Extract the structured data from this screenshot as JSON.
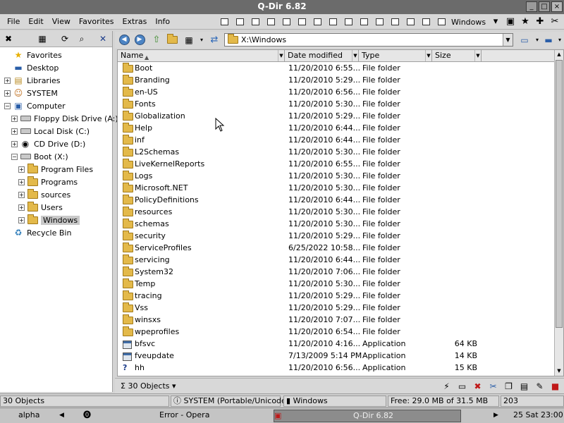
{
  "window": {
    "title": "Q-Dir 6.82"
  },
  "menu": [
    "File",
    "Edit",
    "View",
    "Favorites",
    "Extras",
    "Info"
  ],
  "menubar_right": {
    "windows_label": "Windows"
  },
  "tree": [
    {
      "label": "Favorites",
      "icon": "star-icon",
      "level": 0,
      "expander": ""
    },
    {
      "label": "Desktop",
      "icon": "desktop-icon",
      "level": 0,
      "expander": ""
    },
    {
      "label": "Libraries",
      "icon": "library-icon",
      "level": 0,
      "expander": "+"
    },
    {
      "label": "SYSTEM",
      "icon": "user-icon",
      "level": 0,
      "expander": "+"
    },
    {
      "label": "Computer",
      "icon": "computer-icon",
      "level": 0,
      "expander": "-"
    },
    {
      "label": "Floppy Disk Drive (A:)",
      "icon": "drive-icon",
      "level": 1,
      "expander": "+"
    },
    {
      "label": "Local Disk (C:)",
      "icon": "drive-icon",
      "level": 1,
      "expander": "+"
    },
    {
      "label": "CD Drive (D:)",
      "icon": "cd-icon",
      "level": 1,
      "expander": "+"
    },
    {
      "label": "Boot (X:)",
      "icon": "drive-icon",
      "level": 1,
      "expander": "-"
    },
    {
      "label": "Program Files",
      "icon": "folder-icon",
      "level": 2,
      "expander": "+"
    },
    {
      "label": "Programs",
      "icon": "folder-icon",
      "level": 2,
      "expander": "+"
    },
    {
      "label": "sources",
      "icon": "folder-icon",
      "level": 2,
      "expander": "+"
    },
    {
      "label": "Users",
      "icon": "folder-icon",
      "level": 2,
      "expander": "+"
    },
    {
      "label": "Windows",
      "icon": "folder-icon",
      "level": 2,
      "expander": "+",
      "selected": true
    },
    {
      "label": "Recycle Bin",
      "icon": "recycle-bin-icon",
      "level": 0,
      "expander": ""
    }
  ],
  "address": {
    "path": "X:\\Windows"
  },
  "columns": {
    "name": "Name",
    "date": "Date modified",
    "type": "Type",
    "size": "Size"
  },
  "files": [
    {
      "name": "Boot",
      "date": "11/20/2010 6:55...",
      "type": "File folder",
      "size": "",
      "icon": "folder-icon"
    },
    {
      "name": "Branding",
      "date": "11/20/2010 5:29...",
      "type": "File folder",
      "size": "",
      "icon": "folder-icon"
    },
    {
      "name": "en-US",
      "date": "11/20/2010 6:56...",
      "type": "File folder",
      "size": "",
      "icon": "folder-icon"
    },
    {
      "name": "Fonts",
      "date": "11/20/2010 5:30...",
      "type": "File folder",
      "size": "",
      "icon": "folder-icon"
    },
    {
      "name": "Globalization",
      "date": "11/20/2010 5:29...",
      "type": "File folder",
      "size": "",
      "icon": "folder-icon"
    },
    {
      "name": "Help",
      "date": "11/20/2010 6:44...",
      "type": "File folder",
      "size": "",
      "icon": "folder-icon"
    },
    {
      "name": "inf",
      "date": "11/20/2010 6:44...",
      "type": "File folder",
      "size": "",
      "icon": "folder-icon"
    },
    {
      "name": "L2Schemas",
      "date": "11/20/2010 5:30...",
      "type": "File folder",
      "size": "",
      "icon": "folder-icon"
    },
    {
      "name": "LiveKernelReports",
      "date": "11/20/2010 6:55...",
      "type": "File folder",
      "size": "",
      "icon": "locked-folder-icon"
    },
    {
      "name": "Logs",
      "date": "11/20/2010 5:30...",
      "type": "File folder",
      "size": "",
      "icon": "folder-icon"
    },
    {
      "name": "Microsoft.NET",
      "date": "11/20/2010 5:30...",
      "type": "File folder",
      "size": "",
      "icon": "folder-icon"
    },
    {
      "name": "PolicyDefinitions",
      "date": "11/20/2010 6:44...",
      "type": "File folder",
      "size": "",
      "icon": "folder-icon"
    },
    {
      "name": "resources",
      "date": "11/20/2010 5:30...",
      "type": "File folder",
      "size": "",
      "icon": "folder-icon"
    },
    {
      "name": "schemas",
      "date": "11/20/2010 5:30...",
      "type": "File folder",
      "size": "",
      "icon": "folder-icon"
    },
    {
      "name": "security",
      "date": "11/20/2010 5:29...",
      "type": "File folder",
      "size": "",
      "icon": "folder-icon"
    },
    {
      "name": "ServiceProfiles",
      "date": "6/25/2022 10:58...",
      "type": "File folder",
      "size": "",
      "icon": "folder-icon"
    },
    {
      "name": "servicing",
      "date": "11/20/2010 6:44...",
      "type": "File folder",
      "size": "",
      "icon": "folder-icon"
    },
    {
      "name": "System32",
      "date": "11/20/2010 7:06...",
      "type": "File folder",
      "size": "",
      "icon": "folder-icon"
    },
    {
      "name": "Temp",
      "date": "11/20/2010 5:30...",
      "type": "File folder",
      "size": "",
      "icon": "folder-icon"
    },
    {
      "name": "tracing",
      "date": "11/20/2010 5:29...",
      "type": "File folder",
      "size": "",
      "icon": "folder-icon"
    },
    {
      "name": "Vss",
      "date": "11/20/2010 5:29...",
      "type": "File folder",
      "size": "",
      "icon": "folder-icon"
    },
    {
      "name": "winsxs",
      "date": "11/20/2010 7:07...",
      "type": "File folder",
      "size": "",
      "icon": "folder-icon"
    },
    {
      "name": "wpeprofiles",
      "date": "11/20/2010 6:54...",
      "type": "File folder",
      "size": "",
      "icon": "folder-icon"
    },
    {
      "name": "bfsvc",
      "date": "11/20/2010 4:16...",
      "type": "Application",
      "size": "64 KB",
      "icon": "application-icon"
    },
    {
      "name": "fveupdate",
      "date": "7/13/2009 5:14 PM",
      "type": "Application",
      "size": "14 KB",
      "icon": "application-icon"
    },
    {
      "name": "hh",
      "date": "11/20/2010 6:56...",
      "type": "Application",
      "size": "15 KB",
      "icon": "help-application-icon"
    }
  ],
  "bottombar": {
    "object_count": "30 Objects"
  },
  "status": {
    "objects": "30 Objects",
    "profile": "SYSTEM (Portable/Unicode)",
    "folder": "Windows",
    "free": "Free: 29.0 MB of 31.5 MB",
    "count": "203"
  },
  "taskbar": {
    "left": "alpha",
    "opera": "Error - Opera",
    "qdir": "Q-Dir 6.82",
    "clock": "25 Sat 23:00"
  }
}
